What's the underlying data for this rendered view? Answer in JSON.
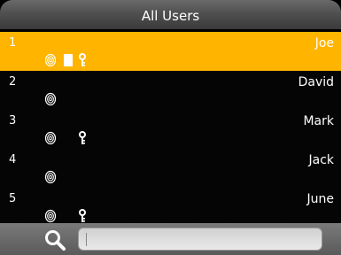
{
  "header": {
    "title": "All Users"
  },
  "users": [
    {
      "id": "1",
      "name": "Joe",
      "selected": true,
      "fingerprint": true,
      "card": true,
      "password": true
    },
    {
      "id": "2",
      "name": "David",
      "selected": false,
      "fingerprint": true,
      "card": false,
      "password": false
    },
    {
      "id": "3",
      "name": "Mark",
      "selected": false,
      "fingerprint": true,
      "card": false,
      "password": true
    },
    {
      "id": "4",
      "name": "Jack",
      "selected": false,
      "fingerprint": true,
      "card": false,
      "password": false
    },
    {
      "id": "5",
      "name": "June",
      "selected": false,
      "fingerprint": true,
      "card": false,
      "password": true
    }
  ],
  "search": {
    "value": "",
    "icon": "search-icon"
  },
  "colors": {
    "selected_row": "#ffb400",
    "background": "#000000"
  },
  "icons": {
    "fingerprint": "fingerprint-icon",
    "card": "card-icon",
    "password": "key-icon"
  }
}
